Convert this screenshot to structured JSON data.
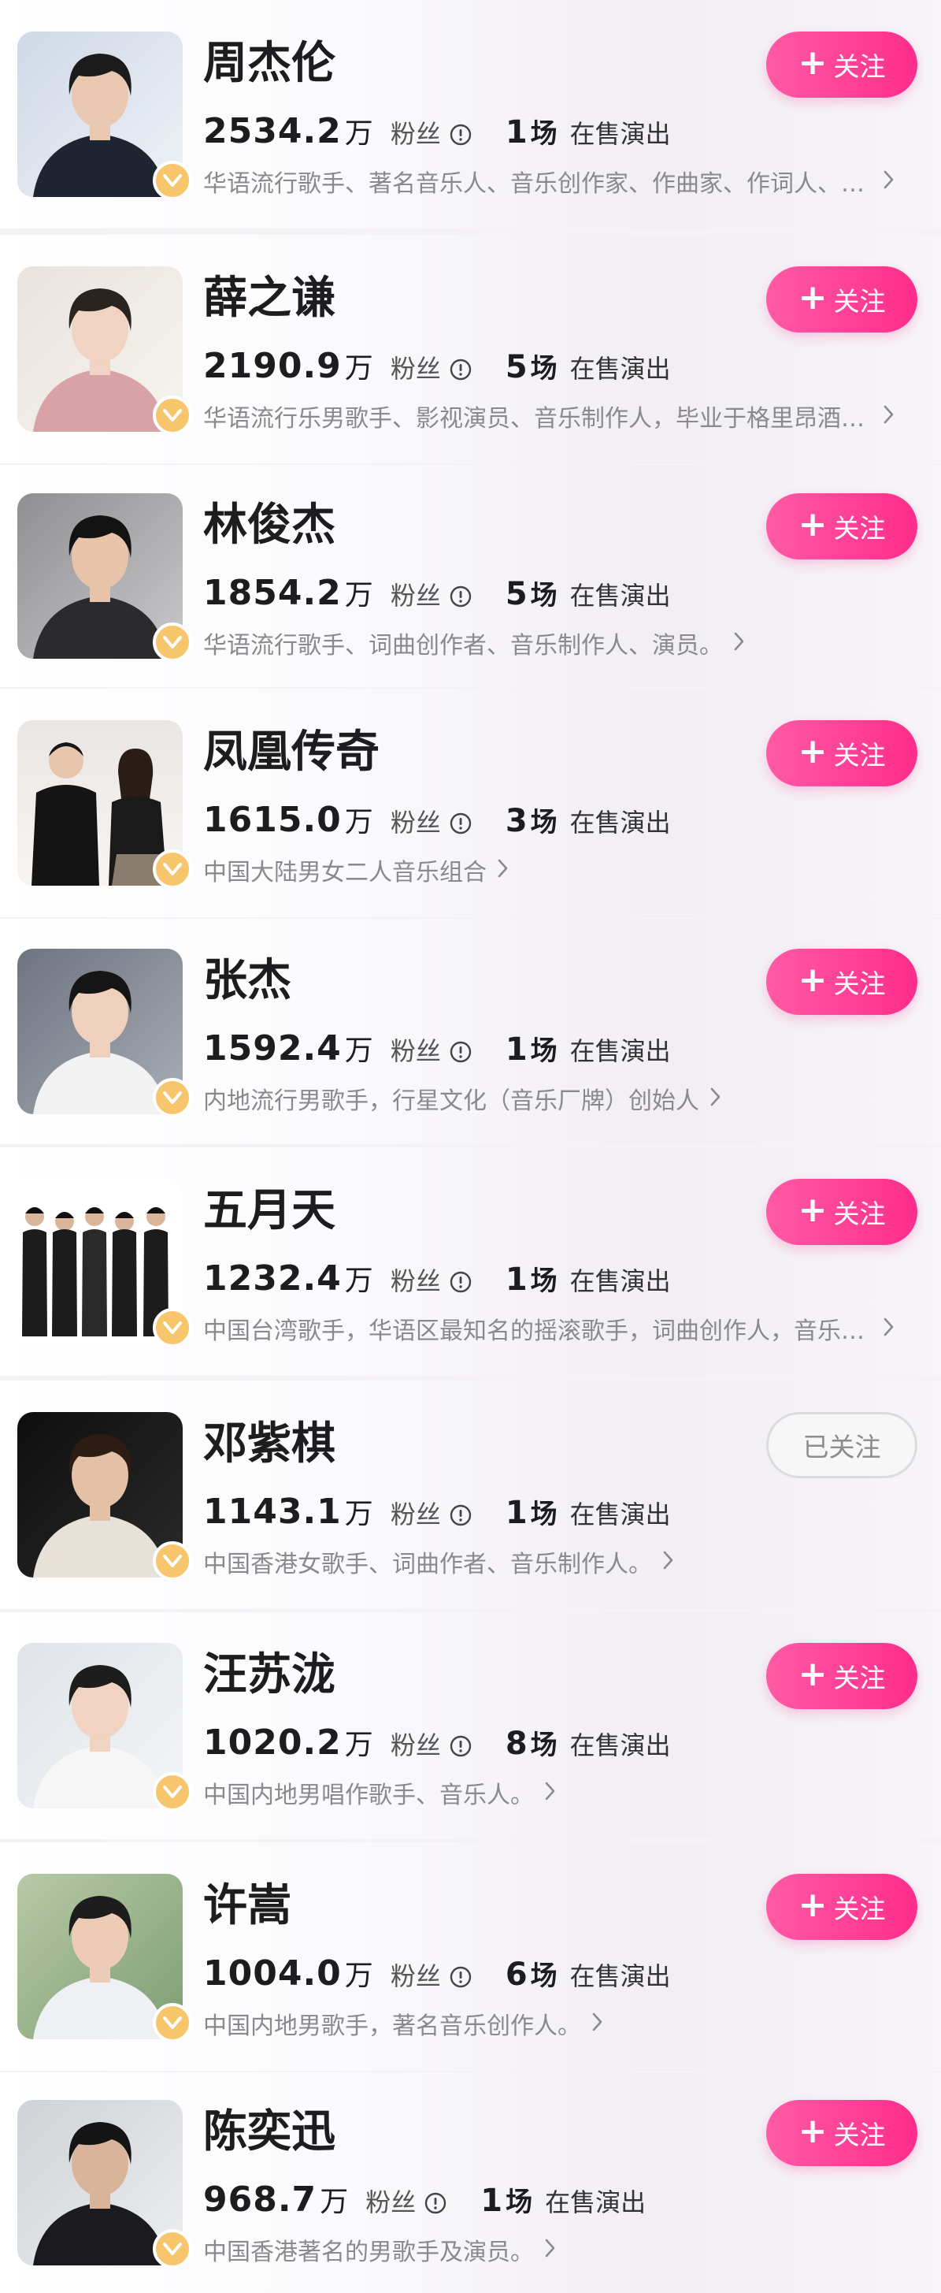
{
  "fans_label": "粉丝",
  "shows_unit": "场",
  "shows_label": "在售演出",
  "fans_unit": "万",
  "follow_label": "关注",
  "followed_label": "已关注",
  "artists": [
    {
      "name": "周杰伦",
      "fans": "2534.2",
      "shows": "1",
      "desc": "华语流行歌手、著名音乐人、音乐创作家、作曲家、作词人、制作人",
      "followed": false
    },
    {
      "name": "薛之谦",
      "fans": "2190.9",
      "shows": "5",
      "desc": "华语流行乐男歌手、影视演员、音乐制作人，毕业于格里昂酒店管理学院",
      "followed": false
    },
    {
      "name": "林俊杰",
      "fans": "1854.2",
      "shows": "5",
      "desc": "华语流行歌手、词曲创作者、音乐制作人、演员。",
      "followed": false
    },
    {
      "name": "凤凰传奇",
      "fans": "1615.0",
      "shows": "3",
      "desc": "中国大陆男女二人音乐组合",
      "followed": false
    },
    {
      "name": "张杰",
      "fans": "1592.4",
      "shows": "1",
      "desc": "内地流行男歌手，行星文化（音乐厂牌）创始人",
      "followed": false
    },
    {
      "name": "五月天",
      "fans": "1232.4",
      "shows": "1",
      "desc": "中国台湾歌手，华语区最知名的摇滚歌手，词曲创作人，音乐制作人",
      "followed": false
    },
    {
      "name": "邓紫棋",
      "fans": "1143.1",
      "shows": "1",
      "desc": "中国香港女歌手、词曲作者、音乐制作人。",
      "followed": true
    },
    {
      "name": "汪苏泷",
      "fans": "1020.2",
      "shows": "8",
      "desc": "中国内地男唱作歌手、音乐人。",
      "followed": false
    },
    {
      "name": "许嵩",
      "fans": "1004.0",
      "shows": "6",
      "desc": "中国内地男歌手，著名音乐创作人。",
      "followed": false
    },
    {
      "name": "陈奕迅",
      "fans": "968.7",
      "shows": "1",
      "desc": "中国香港著名的男歌手及演员。",
      "followed": false
    }
  ],
  "colors": {
    "follow_gradient_start": "#ff5aa6",
    "follow_gradient_end": "#ff2d8b",
    "badge": "#f7c66c"
  }
}
